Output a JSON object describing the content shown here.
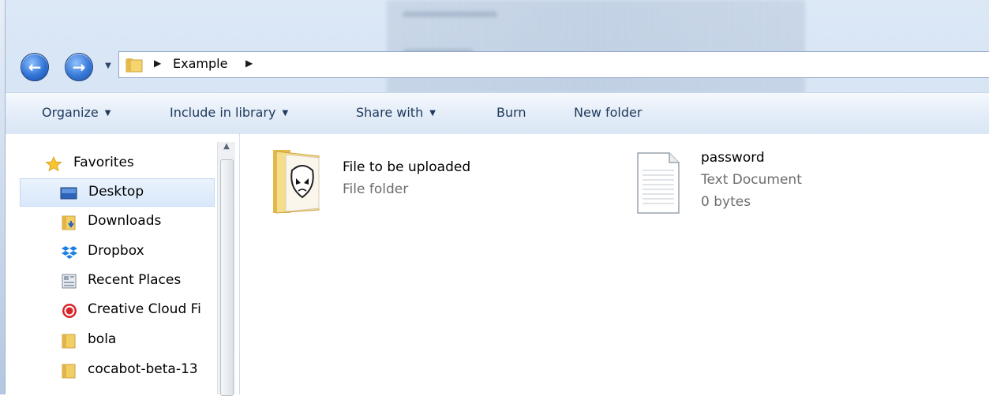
{
  "address": {
    "path": "Example"
  },
  "toolbar": {
    "organize": "Organize",
    "include_in_library": "Include in library",
    "share_with": "Share with",
    "burn": "Burn",
    "new_folder": "New folder"
  },
  "sidebar": {
    "favorites": "Favorites",
    "items": [
      {
        "label": "Desktop",
        "icon": "desktop-icon"
      },
      {
        "label": "Downloads",
        "icon": "downloads-folder-icon"
      },
      {
        "label": "Dropbox",
        "icon": "dropbox-icon"
      },
      {
        "label": "Recent Places",
        "icon": "recent-places-icon"
      },
      {
        "label": "Creative Cloud Fi",
        "icon": "creative-cloud-icon"
      },
      {
        "label": "bola",
        "icon": "folder-icon"
      },
      {
        "label": "cocabot-beta-13",
        "icon": "folder-icon"
      }
    ]
  },
  "files": [
    {
      "name": "File to be uploaded",
      "type": "File folder"
    },
    {
      "name": "password",
      "type": "Text Document",
      "size": "0 bytes"
    }
  ],
  "colors": {
    "accent": "#1e395b",
    "selection": "#d9e8fb"
  }
}
